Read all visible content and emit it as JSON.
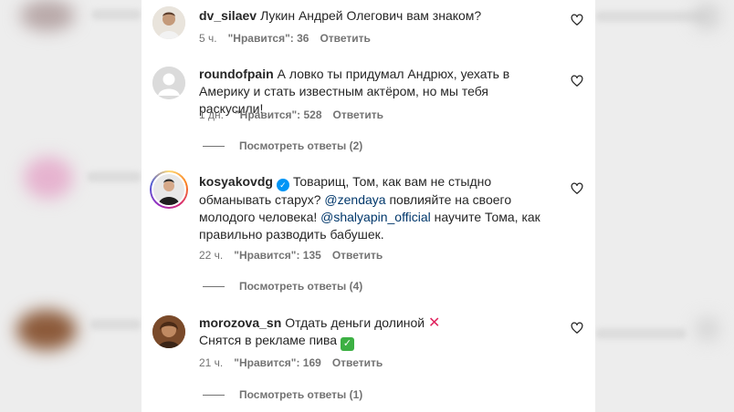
{
  "comments": [
    {
      "username": "dv_silaev",
      "text": "Лукин Андрей Олегович вам знаком?",
      "time": "5 ч.",
      "likes": "\"Нравится\": 36",
      "reply": "Ответить"
    },
    {
      "username": "roundofpain",
      "text": "А ловко ты придумал Андрюх, уехать в Америку и стать известным актёром, но мы тебя раскусили!",
      "time": "1 дн.",
      "likes": "\"Нравится\": 528",
      "reply": "Ответить",
      "view_replies": "Посмотреть ответы (2)"
    },
    {
      "username": "kosyakovdg",
      "verified": true,
      "text_parts": {
        "a": "Товарищ, Том, как вам не стыдно обманывать старух? ",
        "mention1": "@zendaya",
        "b": " повлияйте на своего молодого человека! ",
        "mention2": "@shalyapin_official",
        "c": " научите Тома, как правильно разводить бабушек."
      },
      "time": "22 ч.",
      "likes": "\"Нравится\": 135",
      "reply": "Ответить",
      "view_replies": "Посмотреть ответы (4)"
    },
    {
      "username": "morozova_sn",
      "line1": "Отдать деньги долиной",
      "line2": "Снятся в рекламе пива",
      "time": "21 ч.",
      "likes": "\"Нравится\": 169",
      "reply": "Ответить",
      "view_replies": "Посмотреть ответы (1)"
    }
  ],
  "icons": {
    "heart": "heart-outline-icon",
    "cross": "red-cross-mark-emoji",
    "check": "green-check-mark-emoji"
  },
  "colors": {
    "text": "#262626",
    "secondary": "#737373",
    "mention": "#00376b",
    "verified": "#0095f6"
  }
}
